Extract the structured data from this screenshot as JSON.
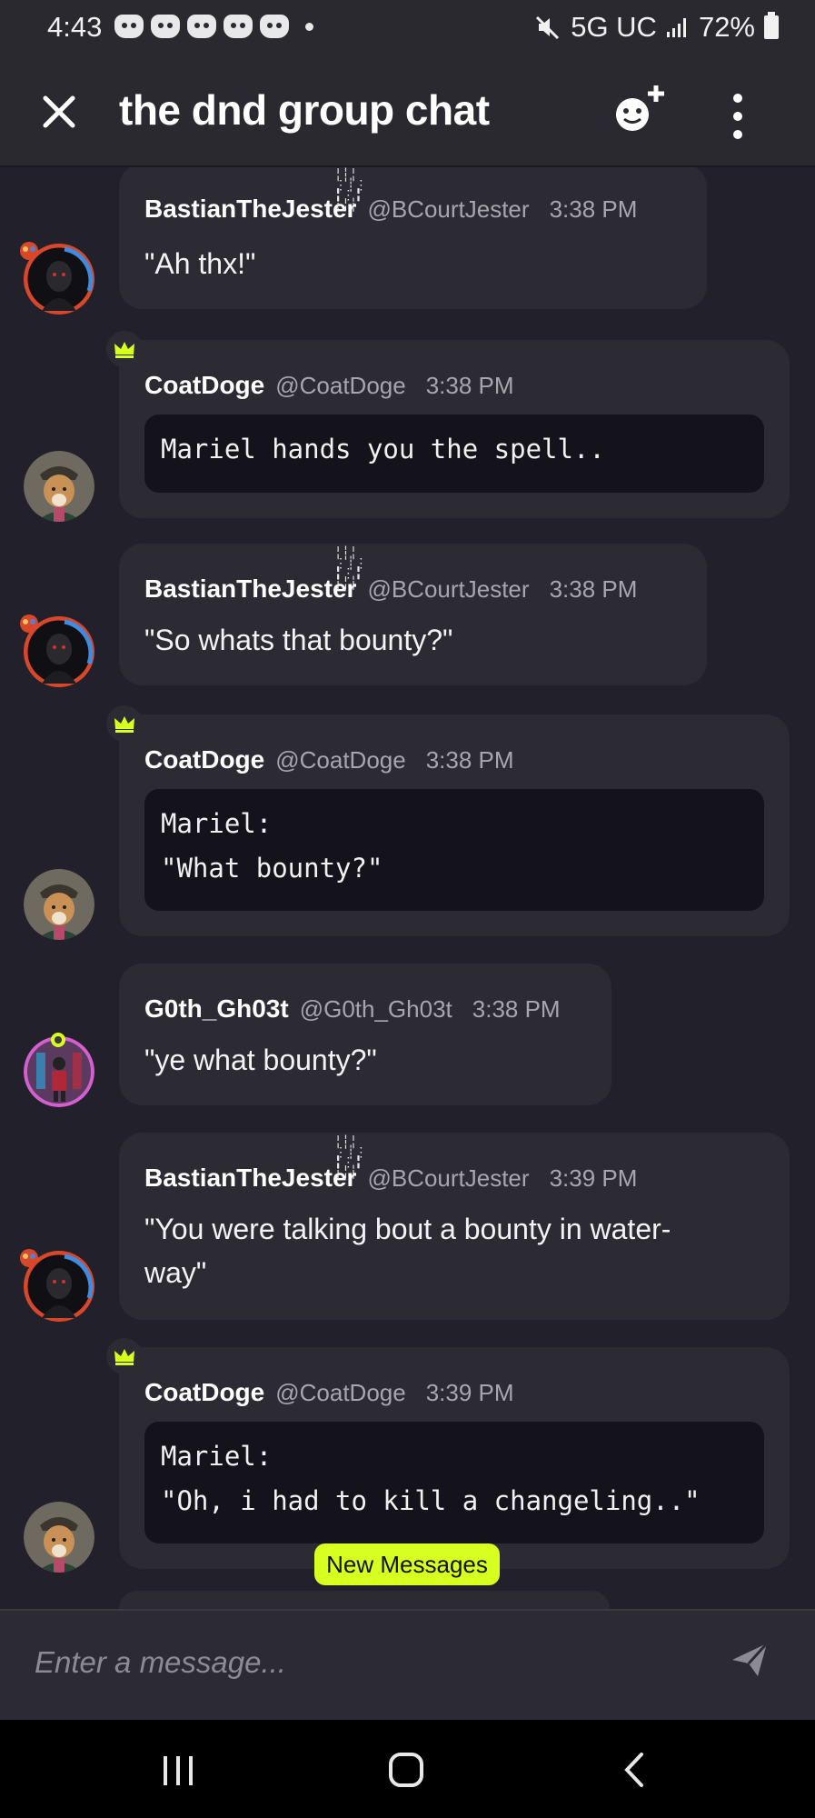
{
  "status_bar": {
    "time": "4:43",
    "network": "5G UC",
    "battery": "72%"
  },
  "header": {
    "title": "the dnd group chat"
  },
  "messages": [
    {
      "username": "BastianTheJester",
      "handle": "@BCourtJester",
      "time": "3:38 PM",
      "text": "\"Ah thx!\""
    },
    {
      "username": "CoatDoge",
      "handle": "@CoatDoge",
      "time": "3:38 PM",
      "code_lines": [
        "Mariel hands you the spell.."
      ]
    },
    {
      "username": "BastianTheJester",
      "handle": "@BCourtJester",
      "time": "3:38 PM",
      "text": "\"So whats that bounty?\""
    },
    {
      "username": "CoatDoge",
      "handle": "@CoatDoge",
      "time": "3:38 PM",
      "code_lines": [
        "Mariel:",
        "\"What bounty?\""
      ]
    },
    {
      "username": "G0th_Gh03t",
      "handle": "@G0th_Gh03t",
      "time": "3:38 PM",
      "text": "\"ye what bounty?\""
    },
    {
      "username": "BastianTheJester",
      "handle": "@BCourtJester",
      "time": "3:39 PM",
      "text_lines": [
        "\"You were talking bout a bounty in water-",
        "way\""
      ]
    },
    {
      "username": "CoatDoge",
      "handle": "@CoatDoge",
      "time": "3:39 PM",
      "code_lines": [
        "Mariel:",
        "\"Oh, i had to kill a changeling..\""
      ]
    }
  ],
  "new_messages_label": "New Messages",
  "input": {
    "placeholder": "Enter a message..."
  },
  "colors": {
    "background": "#22212b",
    "bubble": "#2c2b33",
    "code_bg": "#14131b",
    "accent": "#d7ff1f",
    "crown": "#d7ff1f"
  },
  "icons": {
    "header": [
      "close-icon",
      "add-member-icon",
      "more-icon"
    ],
    "send": "send-icon",
    "nav": [
      "recent-apps-icon",
      "home-icon",
      "back-icon"
    ]
  }
}
